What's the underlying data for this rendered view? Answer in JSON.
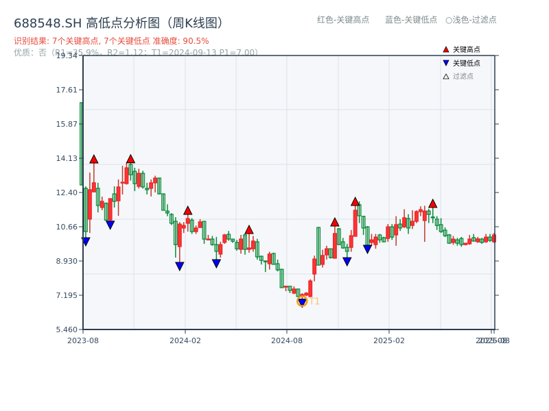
{
  "header": {
    "title": "688548.SH 高低点分析图（周K线图）",
    "result": "识别结果: 7个关键高点, 7个关键低点  准确度: 90.5%",
    "quality": "优质：否（R1=35.9%，R2=1.12；T1=2024-09-13 P1=7.00）",
    "legend_high": "红色-关键高点",
    "legend_low": "蓝色-关键低点",
    "legend_filtered": "○浅色-过滤点"
  },
  "colors": {
    "up": "#e8262a",
    "down": "#0a8a3a",
    "high_marker": "#ff0000",
    "low_marker": "#0000ff",
    "t1_ring": "#f39c12",
    "plot_bg": "#f5f7fa",
    "axis": "#2c3e50"
  },
  "chart_data": {
    "type": "candlestick",
    "ylim": [
      5.46,
      19.34
    ],
    "yticks": [
      "5.460",
      "7.195",
      "8.930",
      "10.66",
      "12.40",
      "14.13",
      "15.87",
      "17.61",
      "19.34"
    ],
    "xticks": [
      "2023-08",
      "2024-02",
      "2024-08",
      "2025-02",
      "2025-08",
      "2025-08"
    ],
    "legend": {
      "high": "关键高点",
      "low": "关键低点",
      "filtered": "过滤点"
    },
    "t1_label": "T1",
    "t1_index": 54,
    "high_markers": [
      3,
      12,
      26,
      41,
      62,
      67,
      86
    ],
    "low_markers": [
      1,
      7,
      24,
      33,
      54,
      65,
      70
    ],
    "ohlc": [
      [
        16.95,
        16.95,
        12.78,
        12.78
      ],
      [
        12.61,
        12.71,
        10.11,
        10.42
      ],
      [
        11.05,
        13.41,
        10.35,
        12.54
      ],
      [
        12.43,
        13.89,
        12.43,
        12.89
      ],
      [
        12.61,
        12.89,
        11.39,
        11.74
      ],
      [
        11.64,
        12.19,
        11.5,
        11.95
      ],
      [
        11.85,
        11.9,
        11.0,
        11.0
      ],
      [
        11.01,
        12.09,
        10.95,
        12.09
      ],
      [
        12.33,
        12.71,
        11.64,
        11.95
      ],
      [
        11.98,
        13.06,
        11.22,
        12.68
      ],
      [
        12.9,
        13.75,
        12.3,
        12.92
      ],
      [
        12.85,
        13.93,
        12.8,
        13.65
      ],
      [
        13.82,
        13.9,
        13.0,
        13.3
      ],
      [
        13.47,
        13.65,
        12.47,
        12.85
      ],
      [
        12.71,
        13.6,
        12.6,
        13.37
      ],
      [
        13.37,
        13.5,
        12.6,
        12.68
      ],
      [
        12.61,
        12.89,
        12.3,
        12.54
      ],
      [
        12.61,
        13.06,
        12.2,
        12.89
      ],
      [
        12.89,
        13.25,
        12.4,
        13.13
      ],
      [
        13.13,
        13.15,
        12.3,
        12.33
      ],
      [
        12.33,
        12.33,
        11.5,
        11.5
      ],
      [
        11.46,
        11.8,
        11.2,
        11.36
      ],
      [
        11.29,
        11.35,
        10.75,
        10.84
      ],
      [
        10.94,
        11.15,
        9.1,
        9.76
      ],
      [
        9.66,
        10.9,
        8.86,
        10.8
      ],
      [
        10.6,
        10.9,
        10.35,
        10.73
      ],
      [
        10.84,
        11.29,
        10.42,
        11.08
      ],
      [
        11.0,
        11.1,
        10.3,
        10.42
      ],
      [
        10.42,
        10.73,
        10.3,
        10.6
      ],
      [
        10.63,
        11.05,
        10.6,
        10.91
      ],
      [
        10.94,
        10.94,
        9.8,
        10.04
      ],
      [
        10.0,
        10.25,
        10.0,
        10.04
      ],
      [
        10.04,
        10.2,
        9.7,
        9.76
      ],
      [
        9.76,
        10.15,
        9.0,
        9.42
      ],
      [
        9.28,
        9.9,
        9.1,
        9.76
      ],
      [
        9.87,
        10.3,
        9.8,
        10.25
      ],
      [
        10.28,
        10.45,
        9.95,
        10.04
      ],
      [
        10.04,
        10.04,
        9.85,
        9.93
      ],
      [
        9.87,
        10.0,
        9.45,
        9.55
      ],
      [
        9.52,
        10.25,
        9.3,
        10.04
      ],
      [
        10.25,
        10.3,
        9.25,
        9.52
      ],
      [
        9.52,
        10.32,
        9.35,
        9.59
      ],
      [
        9.55,
        10.2,
        9.4,
        9.94
      ],
      [
        9.9,
        10.05,
        9.0,
        9.14
      ],
      [
        9.17,
        9.2,
        8.75,
        8.96
      ],
      [
        8.93,
        8.96,
        8.37,
        8.9
      ],
      [
        8.79,
        9.4,
        8.5,
        9.28
      ],
      [
        9.31,
        9.35,
        8.75,
        8.76
      ],
      [
        8.79,
        9.0,
        8.4,
        8.48
      ],
      [
        8.51,
        8.51,
        7.58,
        7.58
      ],
      [
        7.63,
        7.68,
        7.4,
        7.65
      ],
      [
        7.65,
        7.65,
        7.3,
        7.44
      ],
      [
        7.3,
        7.65,
        7.25,
        7.51
      ],
      [
        7.51,
        7.51,
        7.13,
        7.13
      ],
      [
        7.15,
        7.3,
        7.0,
        7.23
      ],
      [
        7.2,
        7.35,
        7.15,
        7.3
      ],
      [
        7.13,
        8.0,
        7.1,
        7.92
      ],
      [
        8.27,
        9.2,
        7.9,
        9.03
      ],
      [
        10.63,
        10.63,
        8.72,
        8.72
      ],
      [
        8.76,
        9.5,
        8.6,
        9.21
      ],
      [
        9.24,
        9.7,
        9.0,
        9.55
      ],
      [
        9.55,
        9.55,
        9.05,
        9.1
      ],
      [
        9.07,
        10.7,
        9.07,
        10.32
      ],
      [
        10.56,
        10.6,
        9.73,
        9.76
      ],
      [
        9.9,
        10.1,
        9.55,
        9.59
      ],
      [
        9.62,
        9.8,
        9.1,
        9.42
      ],
      [
        9.62,
        10.5,
        9.4,
        10.21
      ],
      [
        10.18,
        11.74,
        10.18,
        11.5
      ],
      [
        11.78,
        11.95,
        10.85,
        11.22
      ],
      [
        11.19,
        11.22,
        10.25,
        10.6
      ],
      [
        10.66,
        10.7,
        9.73,
        9.73
      ],
      [
        9.87,
        10.3,
        9.7,
        10.0
      ],
      [
        9.76,
        10.3,
        9.55,
        10.14
      ],
      [
        10.25,
        10.3,
        9.85,
        10.0
      ],
      [
        10.11,
        10.16,
        9.88,
        9.9
      ],
      [
        10.07,
        10.8,
        9.9,
        10.66
      ],
      [
        10.66,
        10.8,
        10.0,
        10.14
      ],
      [
        10.25,
        11.2,
        9.7,
        10.77
      ],
      [
        10.8,
        11.05,
        10.45,
        10.6
      ],
      [
        10.66,
        11.55,
        10.6,
        11.12
      ],
      [
        11.08,
        11.3,
        10.3,
        10.6
      ],
      [
        10.73,
        11.5,
        10.55,
        10.94
      ],
      [
        10.94,
        11.5,
        10.85,
        11.43
      ],
      [
        11.43,
        11.7,
        11.2,
        11.53
      ],
      [
        10.98,
        11.73,
        9.9,
        11.46
      ],
      [
        11.46,
        11.57,
        10.85,
        11.29
      ],
      [
        11.16,
        11.64,
        10.85,
        11.13
      ],
      [
        11.05,
        11.2,
        10.5,
        10.73
      ],
      [
        10.77,
        11.1,
        10.35,
        10.42
      ],
      [
        10.49,
        10.63,
        10.14,
        10.21
      ],
      [
        10.25,
        10.3,
        9.8,
        9.83
      ],
      [
        9.87,
        10.2,
        9.75,
        10.04
      ],
      [
        10.0,
        10.1,
        9.7,
        9.83
      ],
      [
        10.07,
        10.15,
        9.65,
        9.76
      ],
      [
        9.76,
        9.83,
        9.72,
        9.83
      ],
      [
        9.8,
        10.25,
        9.75,
        10.04
      ],
      [
        10.11,
        10.3,
        9.9,
        9.94
      ],
      [
        9.9,
        10.15,
        9.85,
        10.05
      ],
      [
        10.04,
        10.1,
        9.8,
        9.87
      ],
      [
        9.9,
        10.3,
        9.85,
        10.14
      ],
      [
        10.14,
        10.3,
        9.9,
        9.97
      ],
      [
        9.9,
        10.35,
        9.85,
        10.25
      ]
    ]
  }
}
